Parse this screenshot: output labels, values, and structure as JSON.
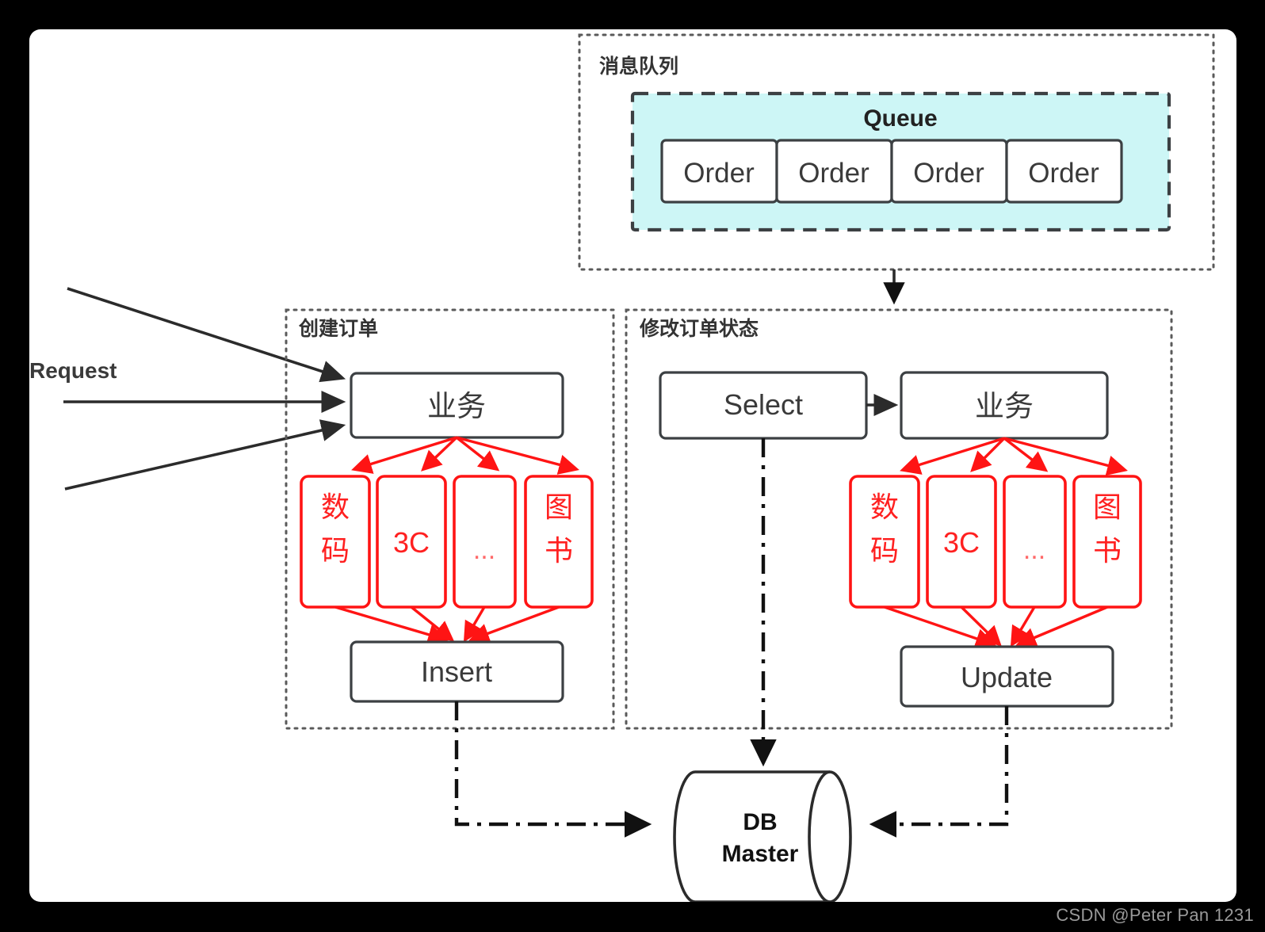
{
  "watermark": "CSDN @Peter Pan 1231",
  "labels": {
    "request": "Request"
  },
  "message_queue": {
    "panel_title": "消息队列",
    "queue_title": "Queue",
    "orders": [
      "Order",
      "Order",
      "Order",
      "Order"
    ]
  },
  "create_order": {
    "panel_title": "创建订单",
    "service": "业务",
    "shards": [
      "数码",
      "3C",
      "...",
      "图书"
    ],
    "action": "Insert"
  },
  "modify_order": {
    "panel_title": "修改订单状态",
    "select": "Select",
    "service": "业务",
    "shards": [
      "数码",
      "3C",
      "...",
      "图书"
    ],
    "action": "Update"
  },
  "database": {
    "line1": "DB",
    "line2": "Master"
  },
  "colors": {
    "queue_fill": "#cdf6f6",
    "shard_red": "#ff1414",
    "shard_red_dim": "#ff6a6a",
    "node_stroke": "#3c4043",
    "panel_stroke": "#5a5a5a",
    "canvas": "#ffffff",
    "background": "#000000",
    "watermark": "#9a9a9a"
  }
}
